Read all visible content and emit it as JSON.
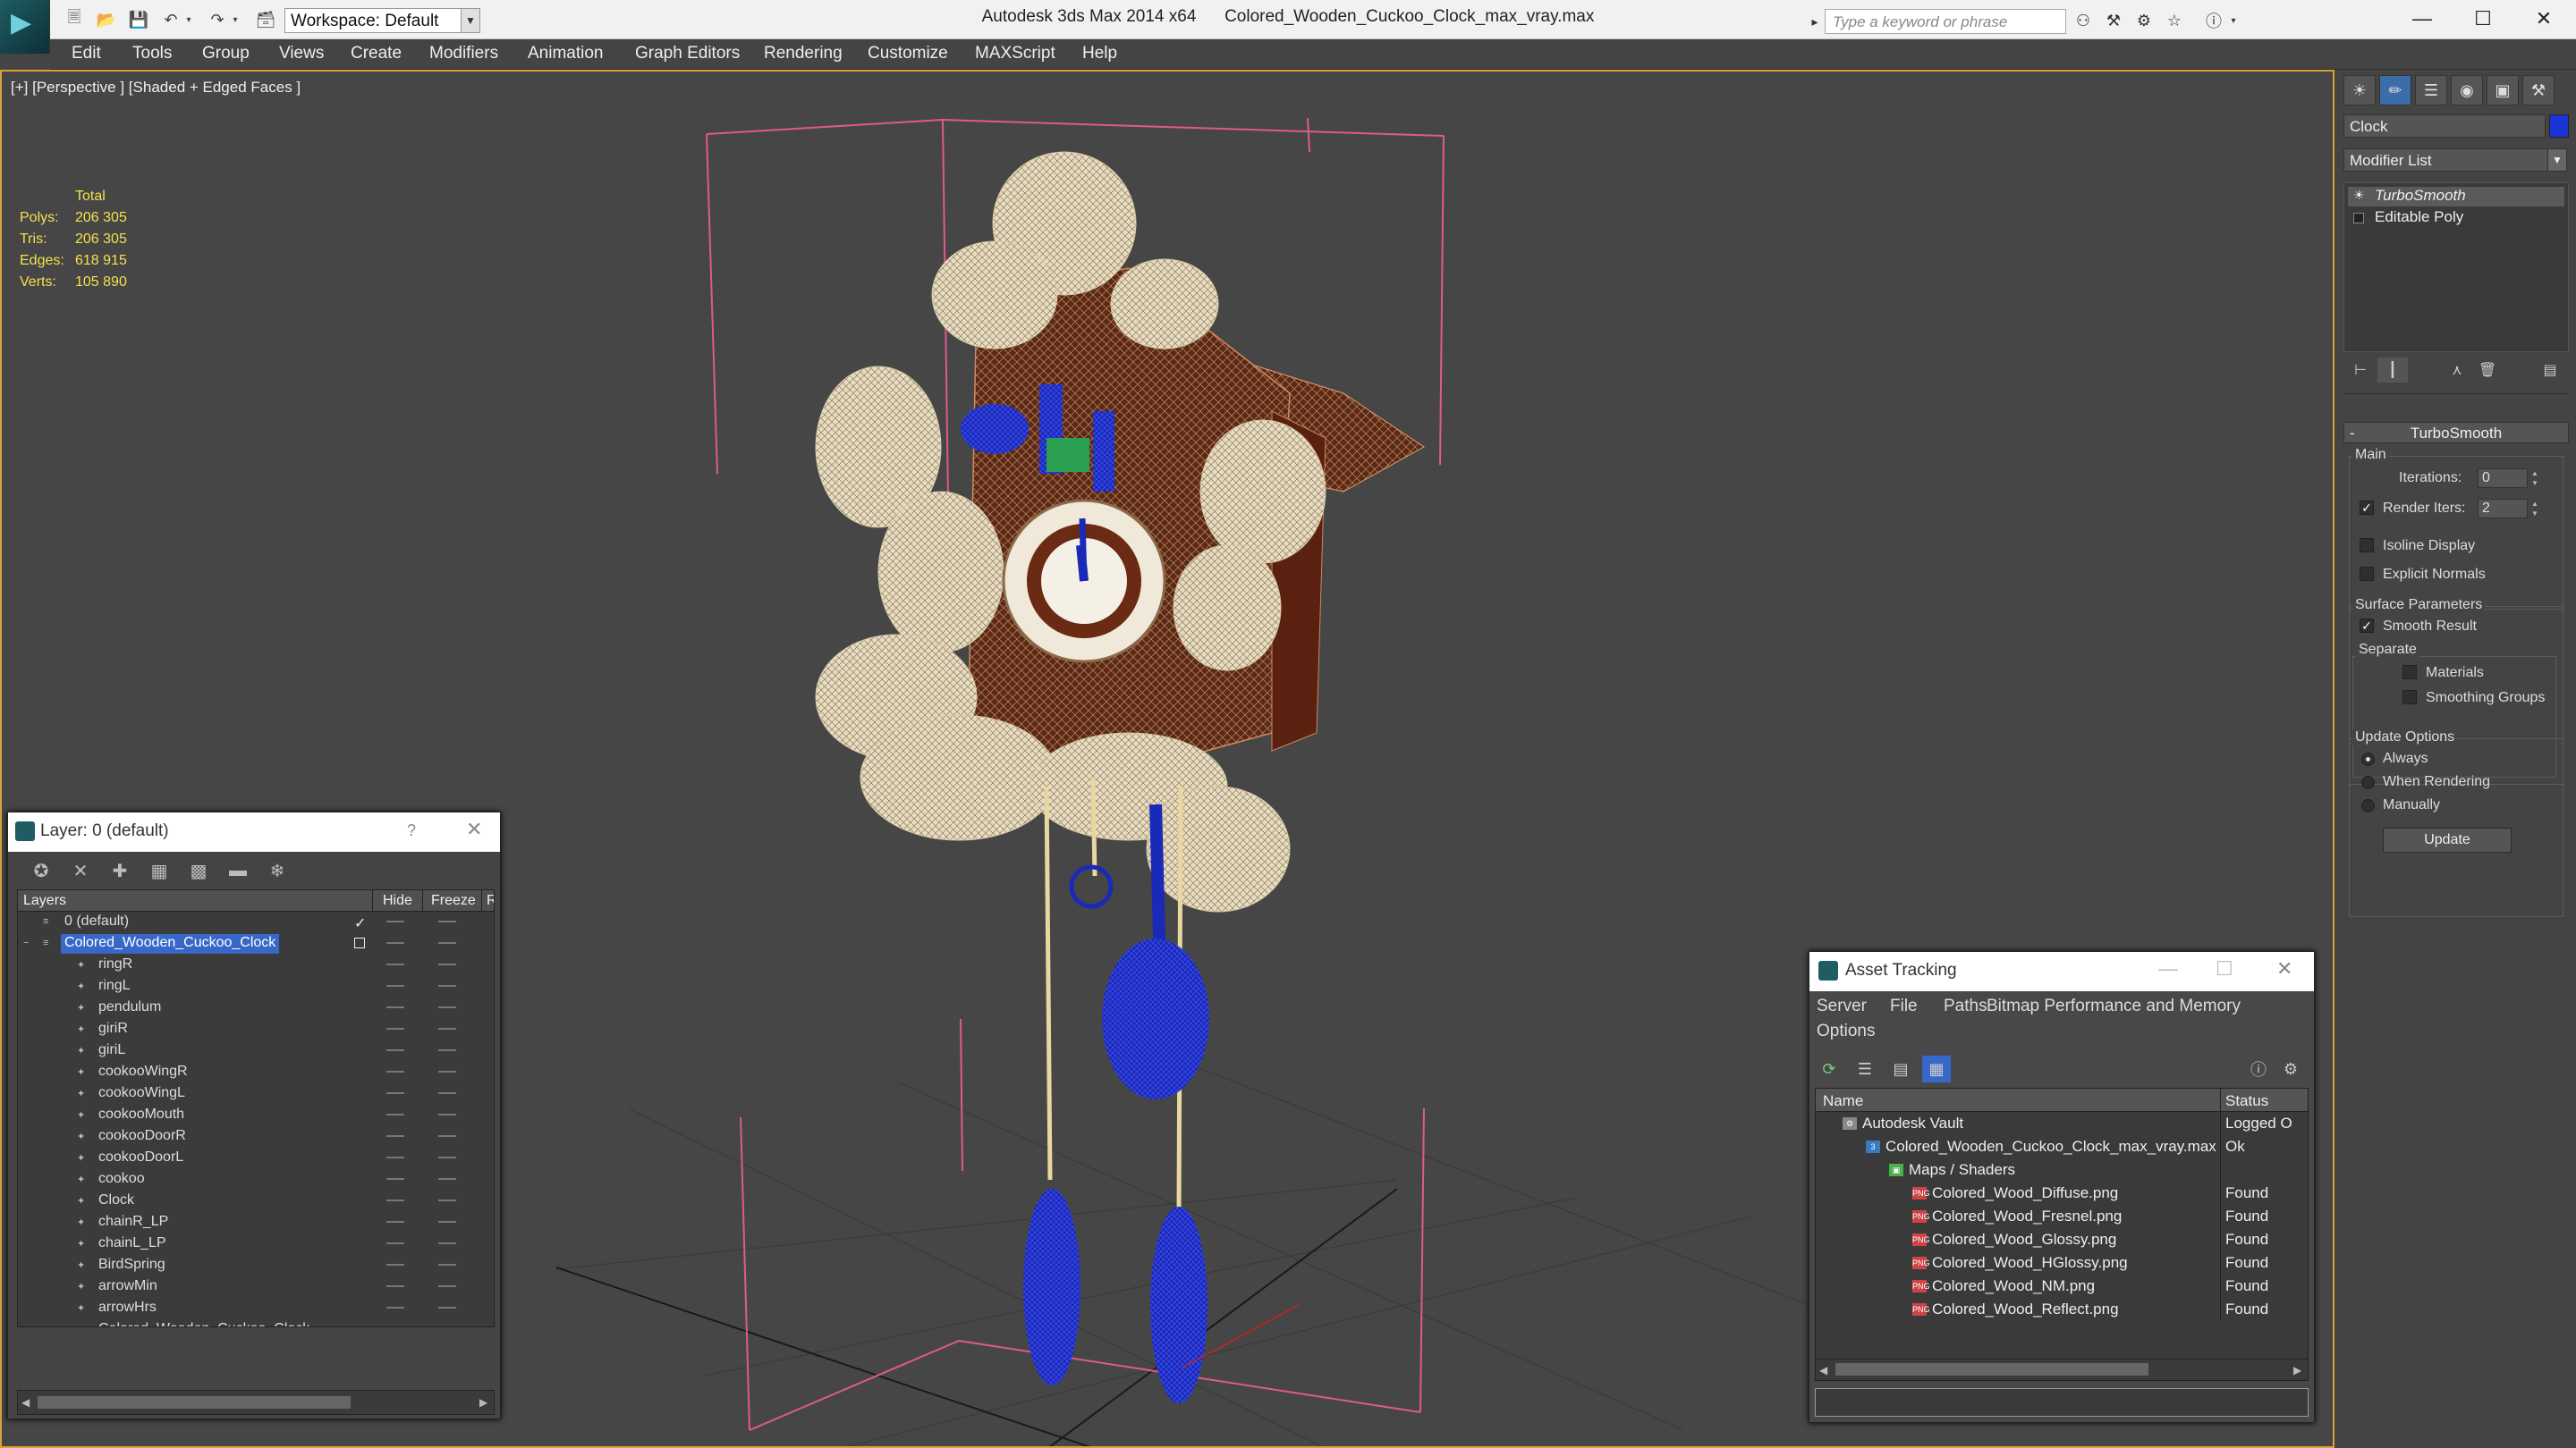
{
  "titlebar": {
    "app_title": "Autodesk 3ds Max 2014 x64",
    "file_title": "Colored_Wooden_Cuckoo_Clock_max_vray.max",
    "workspace_label": "Workspace: Default",
    "search_placeholder": "Type a keyword or phrase"
  },
  "menu": [
    "Edit",
    "Tools",
    "Group",
    "Views",
    "Create",
    "Modifiers",
    "Animation",
    "Graph Editors",
    "Rendering",
    "Customize",
    "MAXScript",
    "Help"
  ],
  "viewport": {
    "label": "[+] [Perspective ] [Shaded + Edged Faces ]",
    "stats": {
      "header": "Total",
      "rows": [
        {
          "label": "Polys:",
          "value": "206 305"
        },
        {
          "label": "Tris:",
          "value": "206 305"
        },
        {
          "label": "Edges:",
          "value": "618 915"
        },
        {
          "label": "Verts:",
          "value": "105 890"
        }
      ]
    }
  },
  "command_panel": {
    "object_name": "Clock",
    "object_color": "#1a35d6",
    "modifier_list": "Modifier List",
    "stack": [
      "TurboSmooth",
      "Editable Poly"
    ],
    "rollout_title": "TurboSmooth",
    "main_group": "Main",
    "iterations_label": "Iterations:",
    "iterations_value": "0",
    "render_iters_label": "Render Iters:",
    "render_iters_value": "2",
    "isoline_label": "Isoline Display",
    "explicit_normals_label": "Explicit Normals",
    "surface_group": "Surface Parameters",
    "smooth_result_label": "Smooth Result",
    "separate_label": "Separate",
    "materials_label": "Materials",
    "smoothing_groups_label": "Smoothing Groups",
    "update_group": "Update Options",
    "always_label": "Always",
    "when_rendering_label": "When Rendering",
    "manually_label": "Manually",
    "update_button": "Update"
  },
  "layer_window": {
    "title": "Layer: 0 (default)",
    "help": "?",
    "columns": {
      "layers": "Layers",
      "hide": "Hide",
      "freeze": "Freeze",
      "render": "R"
    },
    "rows": [
      {
        "name": "0 (default)",
        "level": 1
      },
      {
        "name": "Colored_Wooden_Cuckoo_Clock",
        "level": 1
      },
      {
        "name": "ringR",
        "level": 2
      },
      {
        "name": "ringL",
        "level": 2
      },
      {
        "name": "pendulum",
        "level": 2
      },
      {
        "name": "giriR",
        "level": 2
      },
      {
        "name": "giriL",
        "level": 2
      },
      {
        "name": "cookooWingR",
        "level": 2
      },
      {
        "name": "cookooWingL",
        "level": 2
      },
      {
        "name": "cookooMouth",
        "level": 2
      },
      {
        "name": "cookooDoorR",
        "level": 2
      },
      {
        "name": "cookooDoorL",
        "level": 2
      },
      {
        "name": "cookoo",
        "level": 2
      },
      {
        "name": "Clock",
        "level": 2
      },
      {
        "name": "chainR_LP",
        "level": 2
      },
      {
        "name": "chainL_LP",
        "level": 2
      },
      {
        "name": "BirdSpring",
        "level": 2
      },
      {
        "name": "arrowMin",
        "level": 2
      },
      {
        "name": "arrowHrs",
        "level": 2
      },
      {
        "name": "Colored_Wooden_Cuckoo_Clock",
        "level": 2
      }
    ]
  },
  "asset_window": {
    "title": "Asset Tracking",
    "menu": [
      "Server",
      "File",
      "Paths",
      "Bitmap Performance and Memory",
      "Options"
    ],
    "columns": {
      "name": "Name",
      "status": "Status"
    },
    "rows": [
      {
        "name": "Autodesk Vault",
        "status": "Logged O",
        "level": 0,
        "icon": "vault"
      },
      {
        "name": "Colored_Wooden_Cuckoo_Clock_max_vray.max",
        "status": "Ok",
        "level": 1,
        "icon": "max"
      },
      {
        "name": "Maps / Shaders",
        "status": "",
        "level": 2,
        "icon": "folder"
      },
      {
        "name": "Colored_Wood_Diffuse.png",
        "status": "Found",
        "level": 3,
        "icon": "png"
      },
      {
        "name": "Colored_Wood_Fresnel.png",
        "status": "Found",
        "level": 3,
        "icon": "png"
      },
      {
        "name": "Colored_Wood_Glossy.png",
        "status": "Found",
        "level": 3,
        "icon": "png"
      },
      {
        "name": "Colored_Wood_HGlossy.png",
        "status": "Found",
        "level": 3,
        "icon": "png"
      },
      {
        "name": "Colored_Wood_NM.png",
        "status": "Found",
        "level": 3,
        "icon": "png"
      },
      {
        "name": "Colored_Wood_Reflect.png",
        "status": "Found",
        "level": 3,
        "icon": "png"
      }
    ]
  }
}
